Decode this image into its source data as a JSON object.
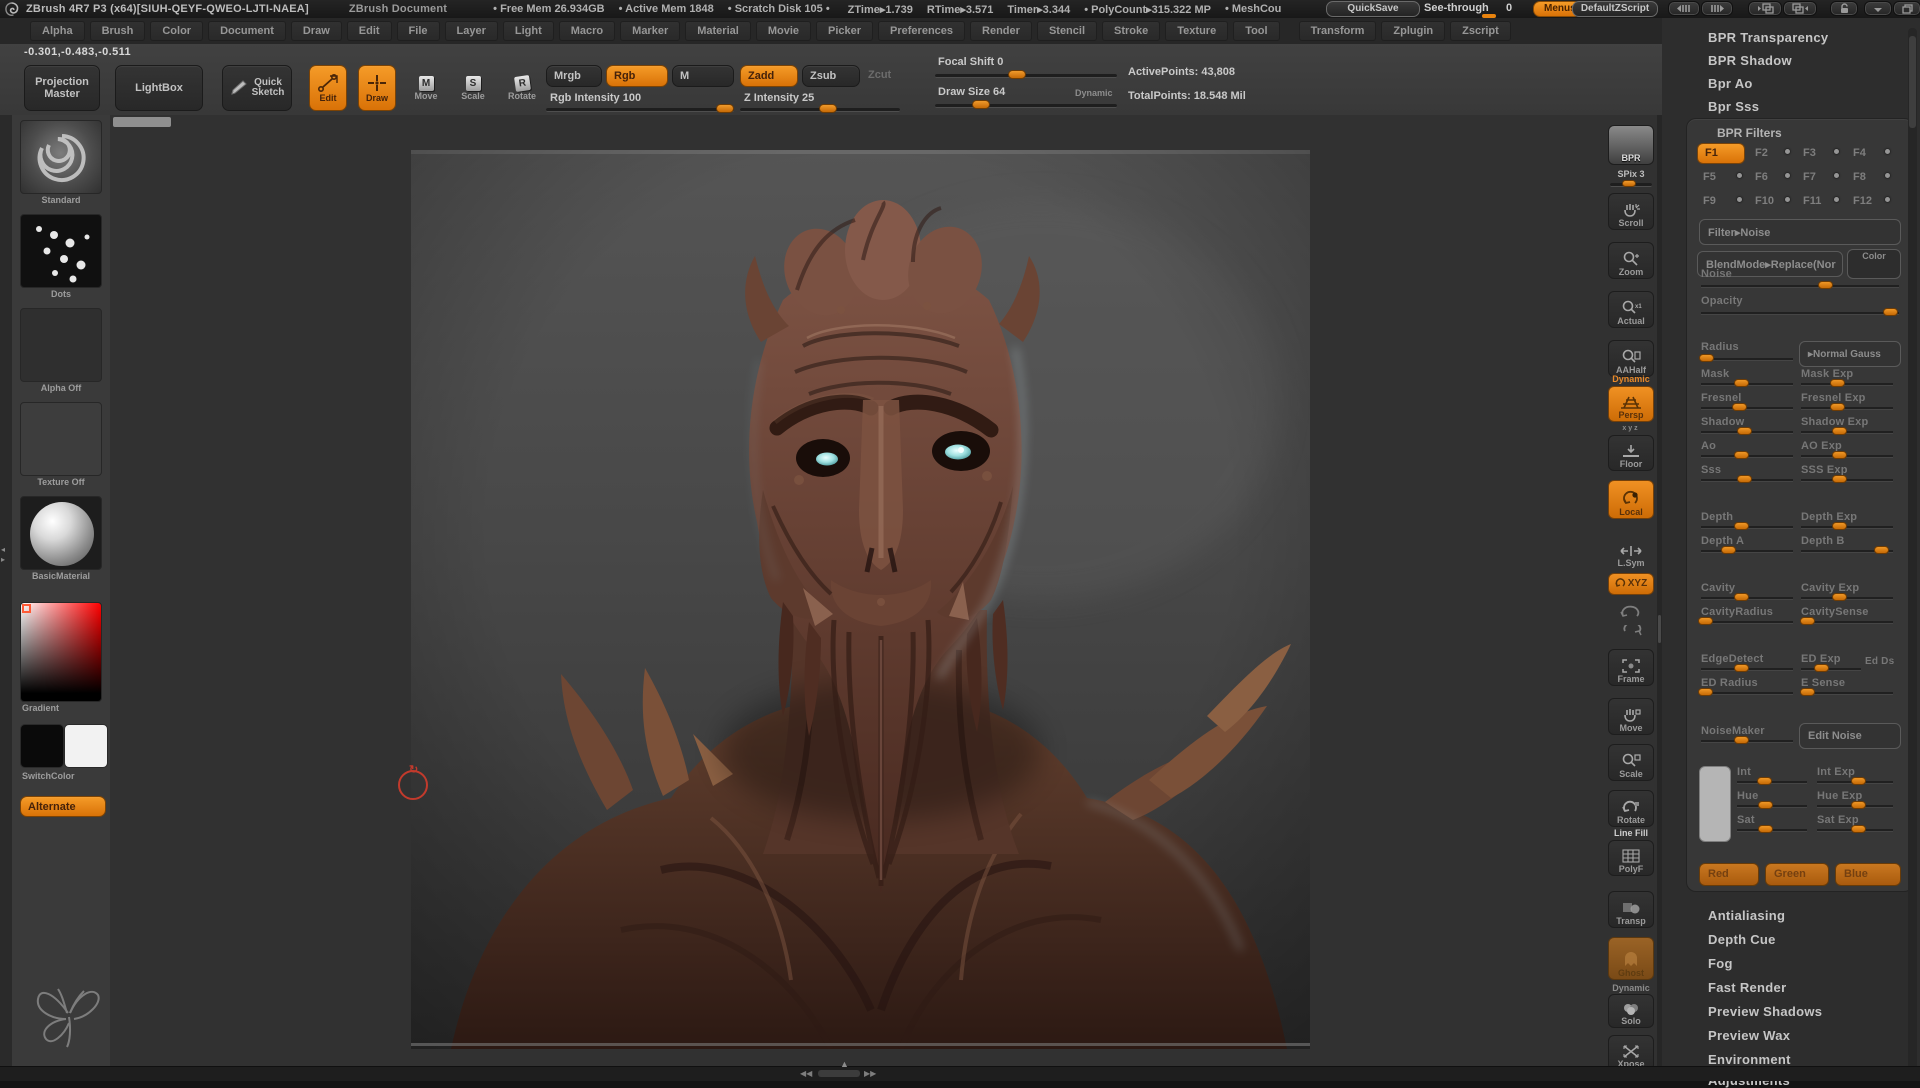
{
  "title_bar": {
    "app_title": "ZBrush 4R7 P3 (x64)[SIUH-QEYF-QWEO-LJTI-NAEA]",
    "document_label": "ZBrush Document",
    "free_mem": "• Free Mem 26.934GB",
    "active_mem": "• Active Mem 1848",
    "scratch_disk": "• Scratch Disk 105 •",
    "ztime": "ZTime▸1.739",
    "rtime": "RTime▸3.571",
    "timer": "Timer▸3.344",
    "polycount": "• PolyCount▸315.322 MP",
    "meshcount": "• MeshCou",
    "quicksave": "QuickSave",
    "see_through": "See-through",
    "see_through_value": "0",
    "menus": "Menus",
    "default_zscript": "DefaultZScript"
  },
  "menu_bar": {
    "items": [
      "Alpha",
      "Brush",
      "Color",
      "Document",
      "Draw",
      "Edit",
      "File",
      "Layer",
      "Light",
      "Macro",
      "Marker",
      "Material",
      "Movie",
      "Picker",
      "Preferences",
      "Render",
      "Stencil",
      "Stroke",
      "Texture",
      "Tool",
      "Transform",
      "Zplugin",
      "Zscript"
    ]
  },
  "top_shelf": {
    "coordinates": "-0.301,-0.483,-0.511",
    "projection_master_line1": "Projection",
    "projection_master_line2": "Master",
    "lightbox": "LightBox",
    "quick_sketch_line1": "Quick",
    "quick_sketch_line2": "Sketch",
    "edit": "Edit",
    "draw": "Draw",
    "move": "Move",
    "scale": "Scale",
    "rotate": "Rotate",
    "mrgb": "Mrgb",
    "rgb": "Rgb",
    "m": "M",
    "rgb_intensity": "Rgb Intensity 100",
    "zadd": "Zadd",
    "zsub": "Zsub",
    "zcut": "Zcut",
    "z_intensity": "Z Intensity 25",
    "focal_shift": "Focal Shift 0",
    "draw_size": "Draw Size 64",
    "dynamic": "Dynamic",
    "active_points": "ActivePoints: 43,808",
    "total_points": "TotalPoints: 18.548 Mil"
  },
  "left_shelf": {
    "standard": "Standard",
    "dots": "Dots",
    "alpha_off": "Alpha Off",
    "texture_off": "Texture Off",
    "basic_material": "BasicMaterial",
    "gradient": "Gradient",
    "switch_color": "SwitchColor",
    "alternate": "Alternate"
  },
  "right_shelf": {
    "bpr": "BPR",
    "spix": "SPix 3",
    "scroll": "Scroll",
    "zoom": "Zoom",
    "actual": "Actual",
    "aahalf": "AAHalf",
    "persp_badge": "Dynamic",
    "persp": "Persp",
    "floor_axes": "xyz",
    "floor": "Floor",
    "local": "Local",
    "lsym": "L.Sym",
    "xyz": "XYZ",
    "frame": "Frame",
    "move": "Move",
    "scale": "Scale",
    "rotate": "Rotate",
    "line_fill": "Line Fill",
    "polyf": "PolyF",
    "transp": "Transp",
    "ghost": "Ghost",
    "solo_badge": "Dynamic",
    "solo": "Solo",
    "xpose": "Xpose"
  },
  "right_panel": {
    "top_items": [
      "BPR Transparency",
      "BPR Shadow",
      "Bpr Ao",
      "Bpr Sss"
    ],
    "filters_header": "BPR Filters",
    "slots": [
      "F1",
      "F2",
      "F3",
      "F4",
      "F5",
      "F6",
      "F7",
      "F8",
      "F9",
      "F10",
      "F11",
      "F12"
    ],
    "filter_dropdown": "Filter▸Noise",
    "blend_dropdown": "BlendMode▸Replace(Nor",
    "color_button": "Color",
    "noise_label": "Noise",
    "opacity_label": "Opacity",
    "radius_label": "Radius",
    "normal_gauss": "▸Normal Gauss",
    "pairs": [
      {
        "l": "Mask",
        "r": "Mask Exp"
      },
      {
        "l": "Fresnel",
        "r": "Fresnel Exp"
      },
      {
        "l": "Shadow",
        "r": "Shadow Exp"
      },
      {
        "l": "Ao",
        "r": "AO Exp"
      },
      {
        "l": "Sss",
        "r": "SSS Exp"
      },
      {
        "l": "Depth",
        "r": "Depth Exp"
      },
      {
        "l": "Depth A",
        "r": "Depth B"
      },
      {
        "l": "Cavity",
        "r": "Cavity Exp"
      },
      {
        "l": "CavityRadius",
        "r": "CavitySense"
      },
      {
        "l": "EdgeDetect",
        "r": "ED Exp"
      },
      {
        "l": "ED Radius",
        "r": "E Sense"
      }
    ],
    "ed_ds": "Ed Ds",
    "noisemaker": "NoiseMaker",
    "edit_noise": "Edit Noise",
    "hsv_pairs": [
      {
        "l": "Int",
        "r": "Int Exp"
      },
      {
        "l": "Hue",
        "r": "Hue Exp"
      },
      {
        "l": "Sat",
        "r": "Sat Exp"
      }
    ],
    "rgb_buttons": [
      "Red",
      "Green",
      "Blue"
    ],
    "bottom_items": [
      "Antialiasing",
      "Depth Cue",
      "Fog",
      "Fast Render",
      "Preview Shadows",
      "Preview Wax",
      "Environment",
      "Adjustments"
    ]
  },
  "colors": {
    "accent": "#e8830e",
    "canvas_top": "#525252",
    "canvas_bottom": "#343434",
    "creature_skin": "#6e4638",
    "eye_glow": "#9fe0e0"
  }
}
